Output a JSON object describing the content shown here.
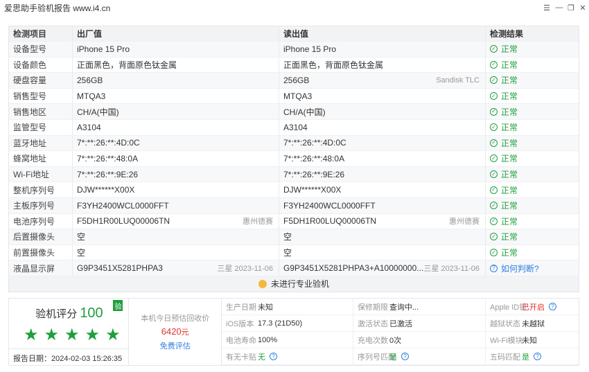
{
  "window": {
    "title": "爱思助手验机报告 www.i4.cn"
  },
  "table": {
    "headers": [
      "检测项目",
      "出厂值",
      "读出值",
      "检测结果"
    ],
    "rows": [
      {
        "item": "设备型号",
        "factory": "iPhone 15 Pro",
        "factory_note": "",
        "read": "iPhone 15 Pro",
        "read_note": "",
        "result": "正常",
        "result_type": "ok"
      },
      {
        "item": "设备颜色",
        "factory": "正面黑色，背面原色钛金属",
        "factory_note": "",
        "read": "正面黑色，背面原色钛金属",
        "read_note": "",
        "result": "正常",
        "result_type": "ok"
      },
      {
        "item": "硬盘容量",
        "factory": "256GB",
        "factory_note": "",
        "read": "256GB",
        "read_note": "Sandisk TLC",
        "result": "正常",
        "result_type": "ok"
      },
      {
        "item": "销售型号",
        "factory": "MTQA3",
        "factory_note": "",
        "read": "MTQA3",
        "read_note": "",
        "result": "正常",
        "result_type": "ok"
      },
      {
        "item": "销售地区",
        "factory": "CH/A(中国)",
        "factory_note": "",
        "read": "CH/A(中国)",
        "read_note": "",
        "result": "正常",
        "result_type": "ok"
      },
      {
        "item": "监管型号",
        "factory": "A3104",
        "factory_note": "",
        "read": "A3104",
        "read_note": "",
        "result": "正常",
        "result_type": "ok"
      },
      {
        "item": "蓝牙地址",
        "factory": "7*:**:26:**:4D:0C",
        "factory_note": "",
        "read": "7*:**:26:**:4D:0C",
        "read_note": "",
        "result": "正常",
        "result_type": "ok"
      },
      {
        "item": "蜂窝地址",
        "factory": "7*:**:26:**:48:0A",
        "factory_note": "",
        "read": "7*:**:26:**:48:0A",
        "read_note": "",
        "result": "正常",
        "result_type": "ok"
      },
      {
        "item": "Wi-Fi地址",
        "factory": "7*:**:26:**:9E:26",
        "factory_note": "",
        "read": "7*:**:26:**:9E:26",
        "read_note": "",
        "result": "正常",
        "result_type": "ok"
      },
      {
        "item": "整机序列号",
        "factory": "DJW******X00X",
        "factory_note": "",
        "read": "DJW******X00X",
        "read_note": "",
        "result": "正常",
        "result_type": "ok"
      },
      {
        "item": "主板序列号",
        "factory": "F3YH2400WCL0000FFT",
        "factory_note": "",
        "read": "F3YH2400WCL0000FFT",
        "read_note": "",
        "result": "正常",
        "result_type": "ok"
      },
      {
        "item": "电池序列号",
        "factory": "F5DH1R00LUQ00006TN",
        "factory_note": "惠州德赛",
        "read": "F5DH1R00LUQ00006TN",
        "read_note": "惠州德赛",
        "result": "正常",
        "result_type": "ok"
      },
      {
        "item": "后置摄像头",
        "factory": "空",
        "factory_note": "",
        "read": "空",
        "read_note": "",
        "result": "正常",
        "result_type": "ok"
      },
      {
        "item": "前置摄像头",
        "factory": "空",
        "factory_note": "",
        "read": "空",
        "read_note": "",
        "result": "正常",
        "result_type": "ok"
      },
      {
        "item": "液晶显示屏",
        "factory": "G9P3451X5281PHPA3",
        "factory_note": "三星 2023-11-06",
        "read": "G9P3451X5281PHPA3+A10000000...",
        "read_note": "三星 2023-11-06",
        "result": "如何判断?",
        "result_type": "link"
      }
    ],
    "footer": "未进行专业验机"
  },
  "summary": {
    "score_label": "验机评分",
    "score": "100",
    "badge": "验",
    "star_count": 5,
    "report_date": "报告日期：2024-02-03 15:26:35",
    "price_label": "本机今日预估回收价",
    "price_value": "6420",
    "price_unit": "元",
    "price_link": "免费评估",
    "info": [
      {
        "k": "生产日期",
        "v": "未知",
        "style": "",
        "help": false
      },
      {
        "k": "保修期限",
        "v": "查询中...",
        "style": "",
        "help": false
      },
      {
        "k": "Apple ID锁",
        "v": "已开启",
        "style": "red",
        "help": true
      },
      {
        "k": "iOS版本",
        "v": "17.3 (21D50)",
        "style": "",
        "help": false
      },
      {
        "k": "激活状态",
        "v": "已激活",
        "style": "",
        "help": false
      },
      {
        "k": "越狱状态",
        "v": "未越狱",
        "style": "",
        "help": false
      },
      {
        "k": "电池寿命",
        "v": "100%",
        "style": "",
        "help": false
      },
      {
        "k": "充电次数",
        "v": "0次",
        "style": "",
        "help": false
      },
      {
        "k": "Wi-Fi模块",
        "v": "未知",
        "style": "",
        "help": false
      },
      {
        "k": "有无卡贴",
        "v": "无",
        "style": "green",
        "help": true
      },
      {
        "k": "序列号匹配",
        "v": "是",
        "style": "green",
        "help": true
      },
      {
        "k": "五码匹配",
        "v": "是",
        "style": "green",
        "help": true
      }
    ]
  }
}
